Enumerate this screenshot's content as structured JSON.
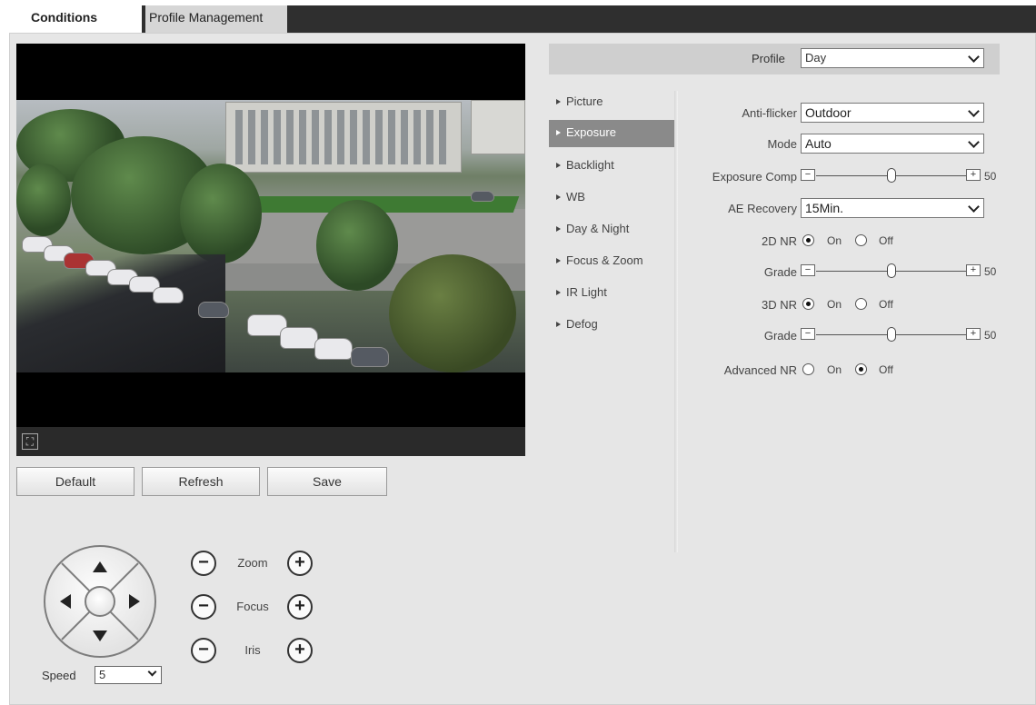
{
  "tabs": [
    {
      "label": "Conditions",
      "active": true
    },
    {
      "label": "Profile Management",
      "active": false
    }
  ],
  "actions": {
    "default_label": "Default",
    "refresh_label": "Refresh",
    "save_label": "Save"
  },
  "ptz": {
    "zoom_label": "Zoom",
    "focus_label": "Focus",
    "iris_label": "Iris",
    "speed_label": "Speed",
    "speed_value": "5"
  },
  "profile": {
    "label": "Profile",
    "value": "Day"
  },
  "menu": [
    {
      "label": "Picture",
      "active": false
    },
    {
      "label": "Exposure",
      "active": true
    },
    {
      "label": "Backlight",
      "active": false
    },
    {
      "label": "WB",
      "active": false
    },
    {
      "label": "Day & Night",
      "active": false
    },
    {
      "label": "Focus & Zoom",
      "active": false
    },
    {
      "label": "IR Light",
      "active": false
    },
    {
      "label": "Defog",
      "active": false
    }
  ],
  "exposure": {
    "anti_flicker": {
      "label": "Anti-flicker",
      "value": "Outdoor"
    },
    "mode": {
      "label": "Mode",
      "value": "Auto"
    },
    "exposure_comp": {
      "label": "Exposure Comp",
      "value": "50",
      "minus": "−",
      "plus": "+"
    },
    "ae_recovery": {
      "label": "AE Recovery",
      "value": "15Min."
    },
    "nr2d": {
      "label": "2D NR",
      "on_label": "On",
      "off_label": "Off",
      "selected": "On"
    },
    "grade2d": {
      "label": "Grade",
      "value": "50",
      "minus": "−",
      "plus": "+"
    },
    "nr3d": {
      "label": "3D NR",
      "on_label": "On",
      "off_label": "Off",
      "selected": "On"
    },
    "grade3d": {
      "label": "Grade",
      "value": "50",
      "minus": "−",
      "plus": "+"
    },
    "advanced_nr": {
      "label": "Advanced NR",
      "on_label": "On",
      "off_label": "Off",
      "selected": "Off"
    }
  },
  "icons": {
    "fullscreen": "fullscreen-icon",
    "ptz_plus": "+",
    "ptz_minus": "−"
  }
}
